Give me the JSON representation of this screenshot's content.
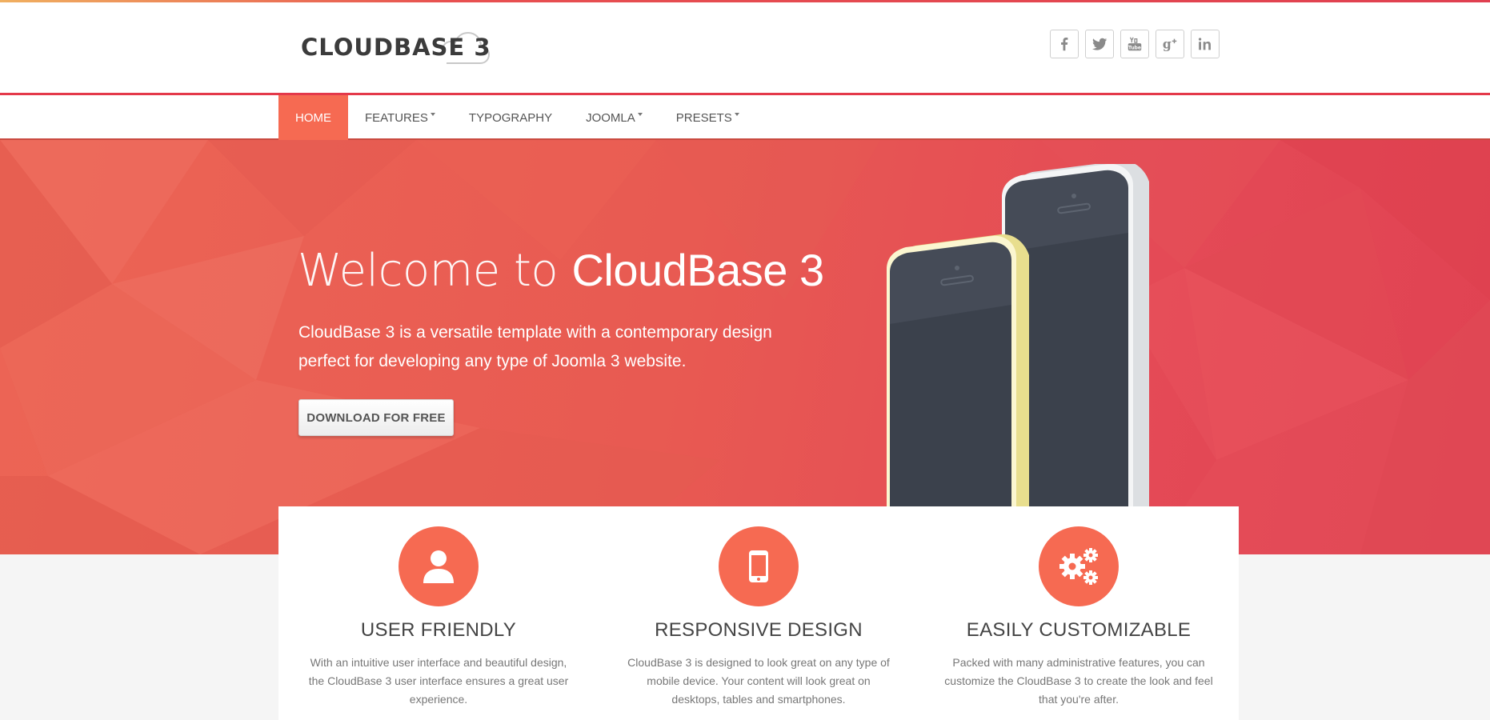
{
  "brand": {
    "logo_text": "CLOUDBASE 3"
  },
  "social": [
    {
      "icon": "facebook-icon",
      "glyph": "f"
    },
    {
      "icon": "twitter-icon",
      "glyph": ""
    },
    {
      "icon": "youtube-icon",
      "glyph": ""
    },
    {
      "icon": "google-plus-icon",
      "glyph": "g+"
    },
    {
      "icon": "linkedin-icon",
      "glyph": "in"
    }
  ],
  "nav": {
    "items": [
      {
        "label": "HOME",
        "active": true,
        "dropdown": false
      },
      {
        "label": "FEATURES",
        "active": false,
        "dropdown": true
      },
      {
        "label": "TYPOGRAPHY",
        "active": false,
        "dropdown": false
      },
      {
        "label": "JOOMLA",
        "active": false,
        "dropdown": true
      },
      {
        "label": "PRESETS",
        "active": false,
        "dropdown": true
      }
    ]
  },
  "hero": {
    "title_thin": "Welcome to ",
    "title_bold": "CloudBase 3",
    "subtitle": "CloudBase 3 is a versatile template with a contemporary design perfect for developing any type of Joomla 3 website.",
    "button_label": "DOWNLOAD FOR FREE"
  },
  "features": [
    {
      "icon": "user-icon",
      "title": "USER FRIENDLY",
      "text": "With an intuitive user interface and beautiful design, the CloudBase 3 user interface ensures a great user experience."
    },
    {
      "icon": "smartphone-icon",
      "title": "RESPONSIVE DESIGN",
      "text": "CloudBase 3 is designed to look great on any type of mobile device. Your content will look great on desktops, tables and smartphones."
    },
    {
      "icon": "gears-icon",
      "title": "EASILY CUSTOMIZABLE",
      "text": "Packed with many administrative features, you can customize the CloudBase 3 to create the look and feel that you're after."
    }
  ],
  "colors": {
    "accent": "#f66a52",
    "hero_red": "#e85a52",
    "nav_border": "#e4394a",
    "text_dark": "#444444"
  }
}
